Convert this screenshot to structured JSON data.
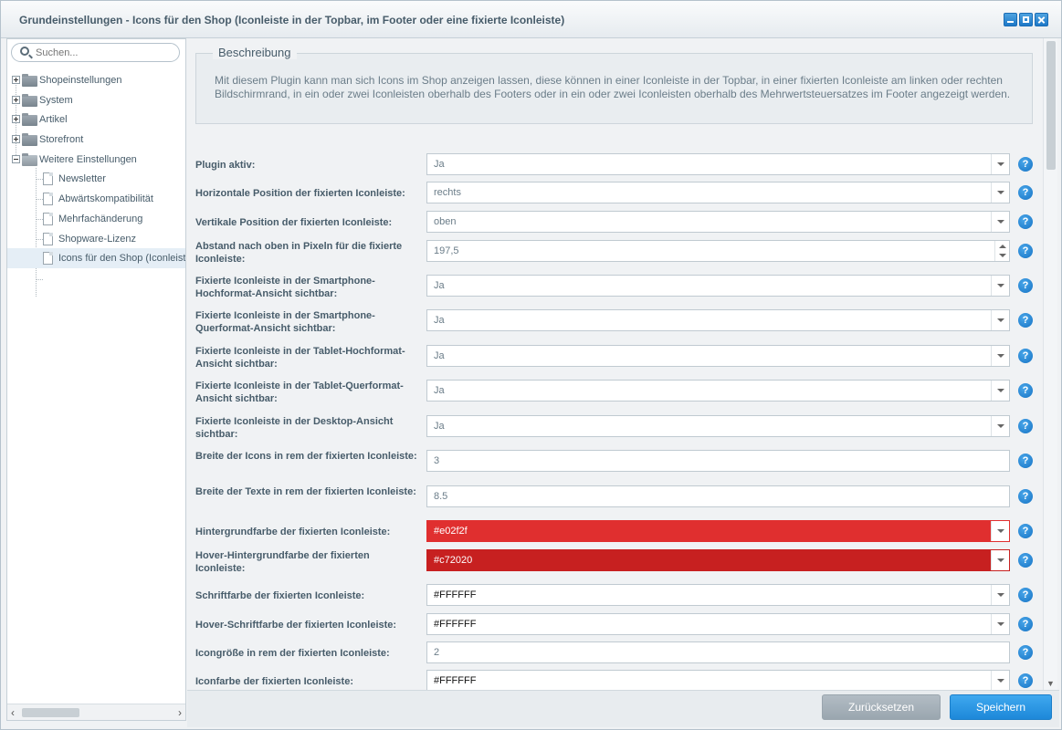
{
  "window": {
    "title": "Grundeinstellungen - Icons für den Shop (Iconleiste in der Topbar, im Footer oder eine fixierte Iconleiste)",
    "buttons": [
      "minimize-icon",
      "maximize-icon",
      "close-icon"
    ]
  },
  "sidebar": {
    "search_placeholder": "Suchen...",
    "items": [
      {
        "label": "Shopeinstellungen"
      },
      {
        "label": "System"
      },
      {
        "label": "Artikel"
      },
      {
        "label": "Storefront"
      },
      {
        "label": "Weitere Einstellungen"
      },
      {
        "label": "Newsletter"
      },
      {
        "label": "Abwärtskompatibilität"
      },
      {
        "label": "Mehrfachänderung"
      },
      {
        "label": "Shopware-Lizenz"
      },
      {
        "label": "Icons für den Shop (Iconleiste"
      }
    ]
  },
  "description": {
    "legend": "Beschreibung",
    "text": "Mit diesem Plugin kann man sich Icons im Shop anzeigen lassen, diese können in einer Iconleiste in der Topbar, in einer fixierten Iconleiste am linken oder rechten Bildschirmrand, in ein oder zwei Iconleisten oberhalb des Footers oder in ein oder zwei Iconleisten oberhalb des Mehrwertsteuersatzes im Footer angezeigt werden."
  },
  "fields": [
    {
      "label": "Plugin aktiv:",
      "value": "Ja"
    },
    {
      "label": "Horizontale Position der fixierten Iconleiste:",
      "value": "rechts"
    },
    {
      "label": "Vertikale Position der fixierten Iconleiste:",
      "value": "oben"
    },
    {
      "label": "Abstand nach oben in Pixeln für die fixierte Iconleiste:",
      "value": "197,5"
    },
    {
      "label": "Fixierte Iconleiste in der Smartphone-Hochformat-Ansicht sichtbar:",
      "value": "Ja"
    },
    {
      "label": "Fixierte Iconleiste in der Smartphone-Querformat-Ansicht sichtbar:",
      "value": "Ja"
    },
    {
      "label": "Fixierte Iconleiste in der Tablet-Hochformat-Ansicht sichtbar:",
      "value": "Ja"
    },
    {
      "label": "Fixierte Iconleiste in der Tablet-Querformat-Ansicht sichtbar:",
      "value": "Ja"
    },
    {
      "label": "Fixierte Iconleiste in der Desktop-Ansicht sichtbar:",
      "value": "Ja"
    },
    {
      "label": "Breite der Icons in rem der fixierten Iconleiste:",
      "value": "3"
    },
    {
      "label": "Breite der Texte in rem der fixierten Iconleiste:",
      "value": "8.5"
    },
    {
      "label": "Hintergrundfarbe der fixierten Iconleiste:",
      "value": "#e02f2f",
      "color": "#e02f2f"
    },
    {
      "label": "Hover-Hintergrundfarbe der fixierten Iconleiste:",
      "value": "#c72020",
      "color": "#c72020"
    },
    {
      "label": "Schriftfarbe der fixierten Iconleiste:",
      "value": "#FFFFFF"
    },
    {
      "label": "Hover-Schriftfarbe der fixierten Iconleiste:",
      "value": "#FFFFFF"
    },
    {
      "label": "Icongröße in rem der fixierten Iconleiste:",
      "value": "2"
    },
    {
      "label": "Iconfarbe der fixierten Iconleiste:",
      "value": "#FFFFFF"
    }
  ],
  "footer": {
    "reset_label": "Zurücksetzen",
    "save_label": "Speichern"
  },
  "colors": {
    "accent": "#1d88d9",
    "help": "#1673c4"
  }
}
